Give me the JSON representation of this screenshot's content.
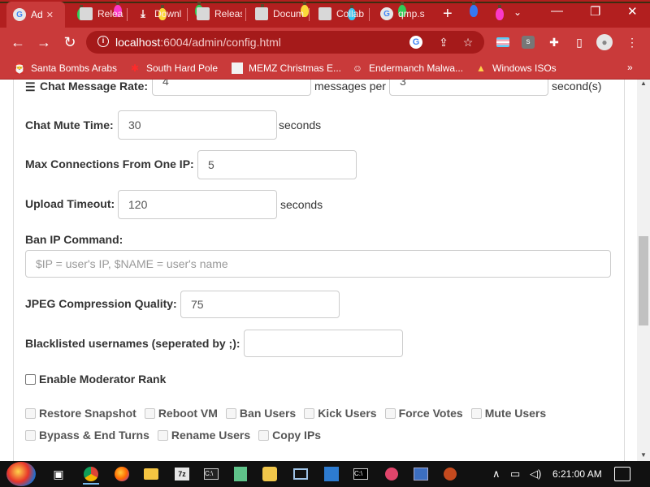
{
  "browser": {
    "tabs": [
      {
        "label": "Ad",
        "icon": "google-g-icon",
        "active": true
      },
      {
        "label": "Releas",
        "icon": "page-icon"
      },
      {
        "label": "Downl",
        "icon": "download-icon"
      },
      {
        "label": "Releas",
        "icon": "page-icon"
      },
      {
        "label": "Docum",
        "icon": "page-icon"
      },
      {
        "label": "Collab",
        "icon": "page-icon"
      },
      {
        "label": "qmp.s",
        "icon": "google-g-icon"
      }
    ],
    "url_host": "localhost",
    "url_path": ":6004/admin/config.html",
    "bookmarks": [
      {
        "label": "Santa Bombs Arabs",
        "icon": "santa-icon"
      },
      {
        "label": "South Hard Pole",
        "icon": "snowflake-icon"
      },
      {
        "label": "MEMZ Christmas E...",
        "icon": "page-icon"
      },
      {
        "label": "Endermanch Malwa...",
        "icon": "enderman-icon"
      },
      {
        "label": "Windows ISOs",
        "icon": "tree-icon"
      }
    ],
    "bookmarks_more": "»",
    "accent_color": "#c93a3a",
    "tabstrip_color": "#b21f1f"
  },
  "config": {
    "chat_rate": {
      "label": "Chat Message Rate:",
      "value": "4",
      "middle": "messages per",
      "value2": "3",
      "suffix": "second(s)"
    },
    "chat_mute": {
      "label": "Chat Mute Time:",
      "value": "30",
      "suffix": "seconds"
    },
    "max_connections": {
      "label": "Max Connections From One IP:",
      "value": "5"
    },
    "upload_timeout": {
      "label": "Upload Timeout:",
      "value": "120",
      "suffix": "seconds"
    },
    "ban_ip": {
      "label": "Ban IP Command:",
      "placeholder": "$IP = user's IP, $NAME = user's name"
    },
    "jpeg_quality": {
      "label": "JPEG Compression Quality:",
      "value": "75"
    },
    "blacklist": {
      "label": "Blacklisted usernames (seperated by ;):",
      "value": ""
    },
    "moderator": {
      "label": "Enable Moderator Rank",
      "checked": false
    },
    "mod_permissions": [
      "Restore Snapshot",
      "Reboot VM",
      "Ban Users",
      "Kick Users",
      "Force Votes",
      "Mute Users",
      "Bypass & End Turns",
      "Rename Users",
      "Copy IPs"
    ]
  },
  "taskbar": {
    "clock": "6:21:00 AM",
    "apps": [
      "task-view-icon",
      "chrome-icon",
      "firefox-icon",
      "file-explorer-icon",
      "7zip-icon",
      "terminal-icon",
      "notepad-icon",
      "paint-icon",
      "monitor-icon",
      "vscode-icon",
      "cmd-icon",
      "app-icon",
      "network-icon",
      "browser-icon"
    ]
  }
}
